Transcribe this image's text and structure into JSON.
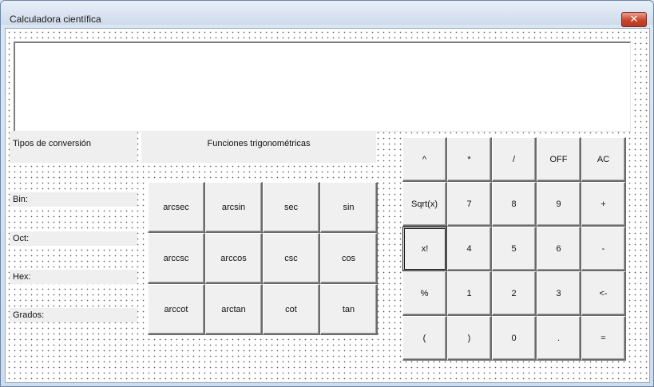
{
  "window": {
    "title": "Calculadora científica",
    "close_label": "✕"
  },
  "display": {
    "value": ""
  },
  "labels": {
    "conversion": "Tipos de conversión",
    "trig": "Funciones trigonométricas",
    "bin": "Bin:",
    "oct": "Oct:",
    "hex": "Hex:",
    "grados": "Grados:"
  },
  "trig_buttons": [
    [
      "arcsec",
      "arcsin",
      "sec",
      "sin"
    ],
    [
      "arccsc",
      "arccos",
      "csc",
      "cos"
    ],
    [
      "arccot",
      "arctan",
      "cot",
      "tan"
    ]
  ],
  "keypad": [
    [
      "^",
      "*",
      "/",
      "OFF",
      "AC"
    ],
    [
      "Sqrt(x)",
      "7",
      "8",
      "9",
      "+"
    ],
    [
      "x!",
      "4",
      "5",
      "6",
      "-"
    ],
    [
      "%",
      "1",
      "2",
      "3",
      "<-"
    ],
    [
      "(",
      ")",
      "0",
      ".",
      "="
    ]
  ]
}
